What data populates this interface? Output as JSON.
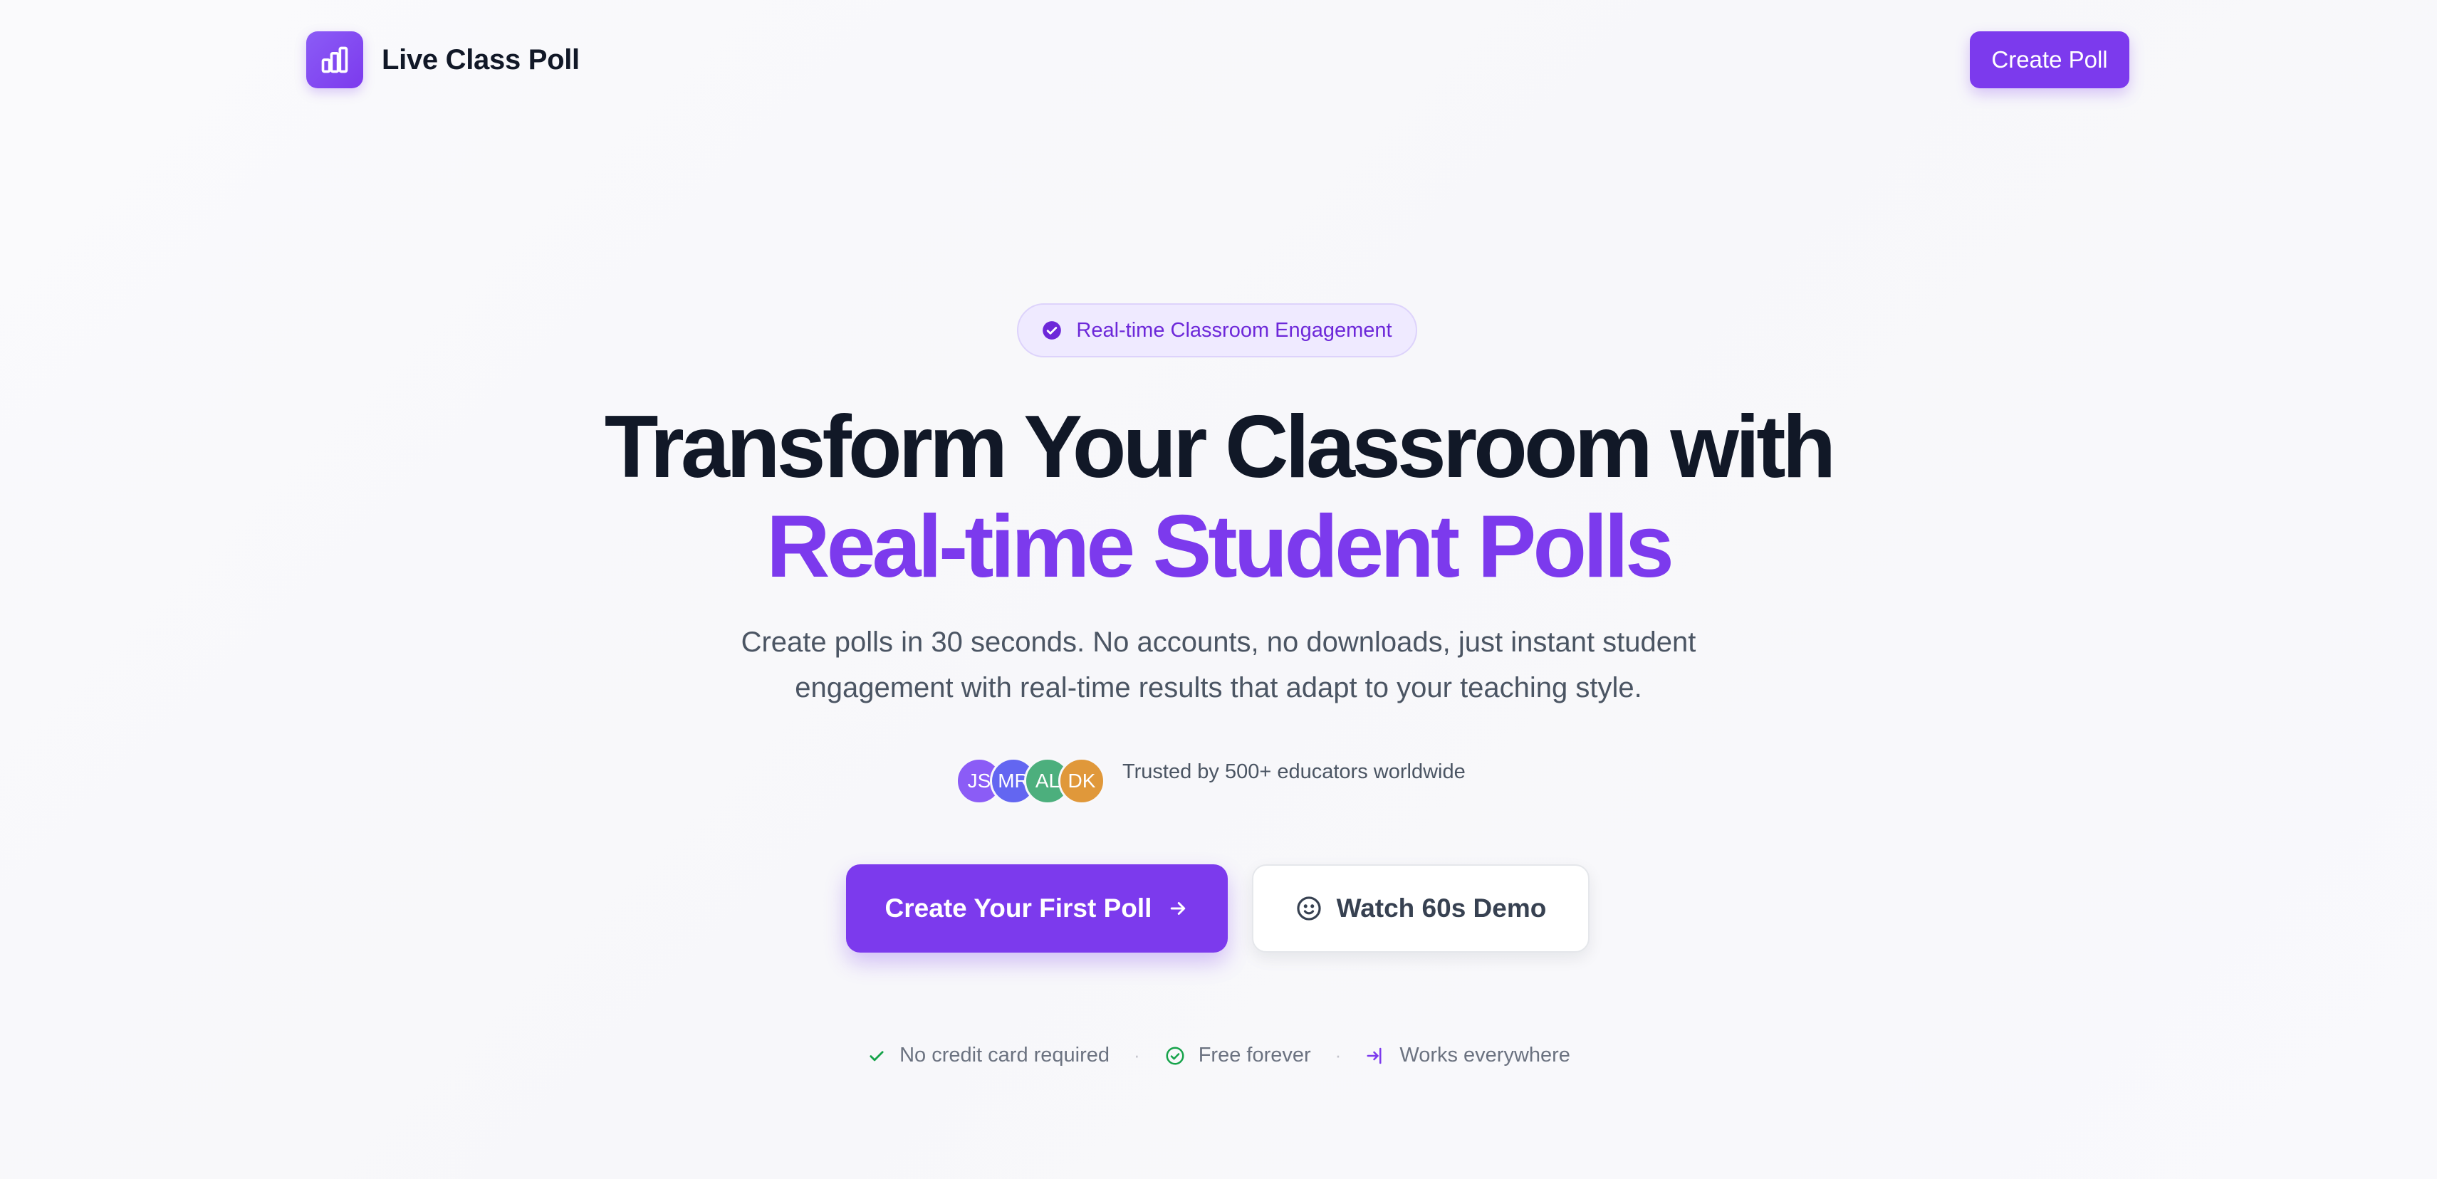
{
  "header": {
    "brand_name": "Live Class Poll",
    "brand_icon": "bar-chart-icon",
    "create_poll_label": "Create Poll"
  },
  "hero": {
    "badge": "Real-time Classroom Engagement",
    "headline_line1": "Transform Your Classroom with",
    "headline_line2": "Real-time Student Polls",
    "subtitle_line1": "Create polls in 30 seconds. No accounts, no downloads, just instant student",
    "subtitle_line2": "engagement with real-time results that adapt to your teaching style.",
    "avatars": [
      {
        "initials": "JS",
        "color": "#8b5cf6"
      },
      {
        "initials": "MR",
        "color": "#6366f1"
      },
      {
        "initials": "AL",
        "color": "#4caf7d"
      },
      {
        "initials": "DK",
        "color": "#e0983a"
      }
    ],
    "trust_text": "Trusted by 500+ educators worldwide",
    "primary_cta": "Create Your First Poll",
    "secondary_cta": "Watch 60s Demo",
    "features": [
      {
        "label": "No credit card required",
        "icon": "check-icon"
      },
      {
        "label": "Free forever",
        "icon": "check-circle-icon"
      },
      {
        "label": "Works everywhere",
        "icon": "device-icon"
      }
    ]
  },
  "colors": {
    "accent": "#7c3aed",
    "heading": "#111827",
    "body": "#4b5563",
    "feature_check": "#16a34a"
  }
}
